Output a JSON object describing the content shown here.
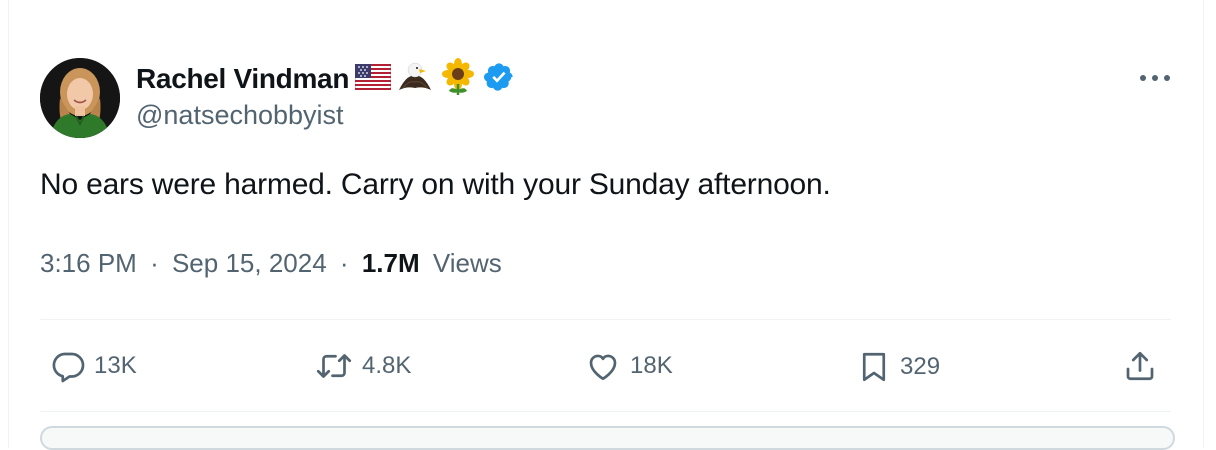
{
  "tweet": {
    "author": {
      "display_name": "Rachel Vindman",
      "handle": "@natsechobbyist",
      "name_emojis": [
        "us-flag-icon",
        "eagle-icon",
        "sunflower-icon"
      ],
      "verified": true,
      "verified_color": "#1d9bf0"
    },
    "text": "No ears were harmed. Carry on with your Sunday afternoon.",
    "meta": {
      "time": "3:16 PM",
      "separator": "·",
      "date": "Sep 15, 2024",
      "views_count": "1.7M",
      "views_label": "Views"
    },
    "actions": {
      "replies": "13K",
      "reposts": "4.8K",
      "likes": "18K",
      "bookmarks": "329"
    }
  },
  "colors": {
    "text_primary": "#0f1419",
    "text_secondary": "#536471",
    "divider": "#eff3f4",
    "accent": "#1d9bf0"
  }
}
